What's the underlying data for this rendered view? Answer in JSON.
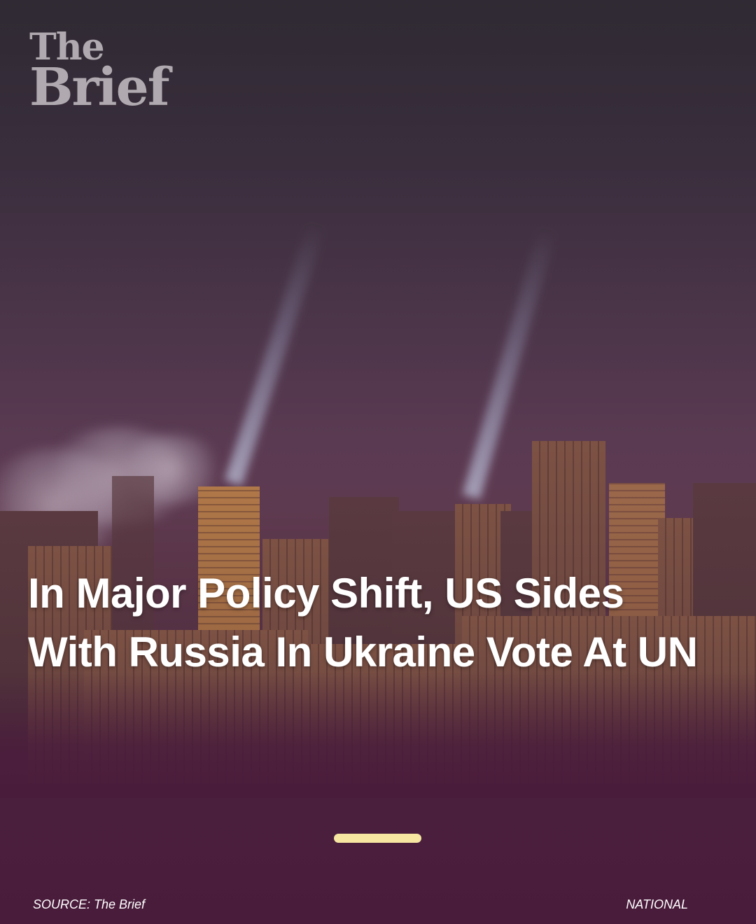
{
  "brand": {
    "line1": "The",
    "line2": "Brief",
    "logo_color": "#b0aab0"
  },
  "headline": "In Major Policy Shift, US Sides With Russia In Ukraine Vote At UN",
  "pager": {
    "color": "#f6e6a2"
  },
  "footer": {
    "source": "SOURCE: The Brief",
    "category": "NATIONAL"
  },
  "colors": {
    "background": "#4a1c3c",
    "text": "#ffffff"
  }
}
